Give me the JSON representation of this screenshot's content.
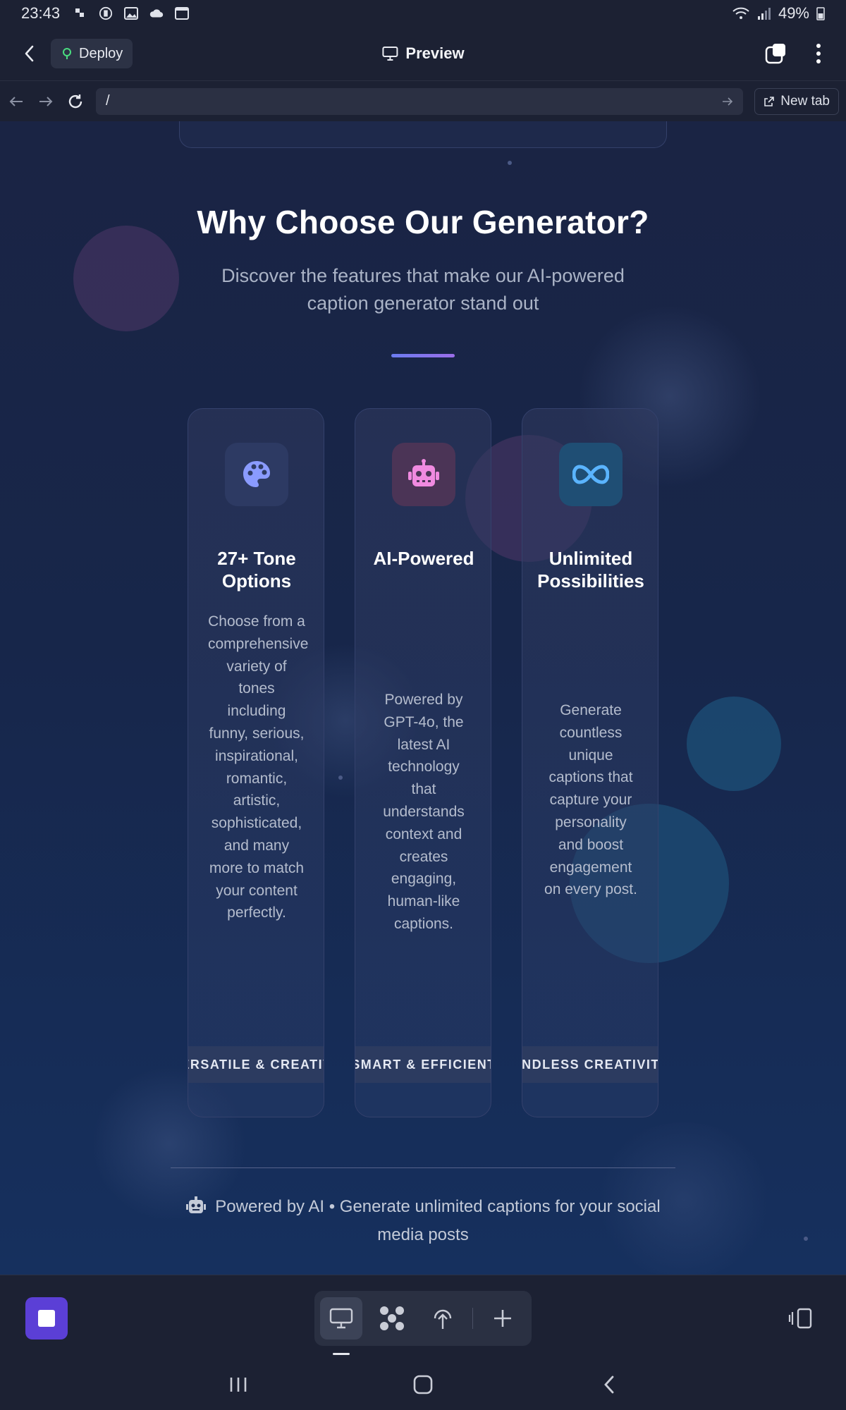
{
  "status_bar": {
    "time": "23:43",
    "battery": "49%"
  },
  "app_header": {
    "deploy_label": "Deploy",
    "title": "Preview"
  },
  "browser_bar": {
    "url": "/",
    "new_tab_label": "New tab"
  },
  "section": {
    "title": "Why Choose Our Generator?",
    "subtitle": "Discover the features that make our AI-powered caption generator stand out"
  },
  "cards": [
    {
      "icon": "palette-icon",
      "title": "27+ Tone Options",
      "description": "Choose from a comprehensive variety of tones including funny, serious, inspirational, romantic, artistic, sophisticated, and many more to match your content perfectly.",
      "band": "VERSATILE & CREATIVE"
    },
    {
      "icon": "robot-icon",
      "title": "AI-Powered",
      "description": "Powered by GPT-4o, the latest AI technology that understands context and creates engaging, human-like captions.",
      "band": "SMART & EFFICIENT"
    },
    {
      "icon": "infinity-icon",
      "title": "Unlimited Possibilities",
      "description": "Generate countless unique captions that capture your personality and boost engagement on every post.",
      "band": "ENDLESS CREATIVITY"
    }
  ],
  "footer": {
    "note": "Powered by AI • Generate unlimited captions for your social media posts"
  },
  "colors": {
    "accent_purple": "#5b3fd6",
    "background": "#1a2444",
    "palette_icon": "#8a9bff",
    "robot_icon": "#f08ae0",
    "infinity_icon": "#5ab4ff"
  }
}
